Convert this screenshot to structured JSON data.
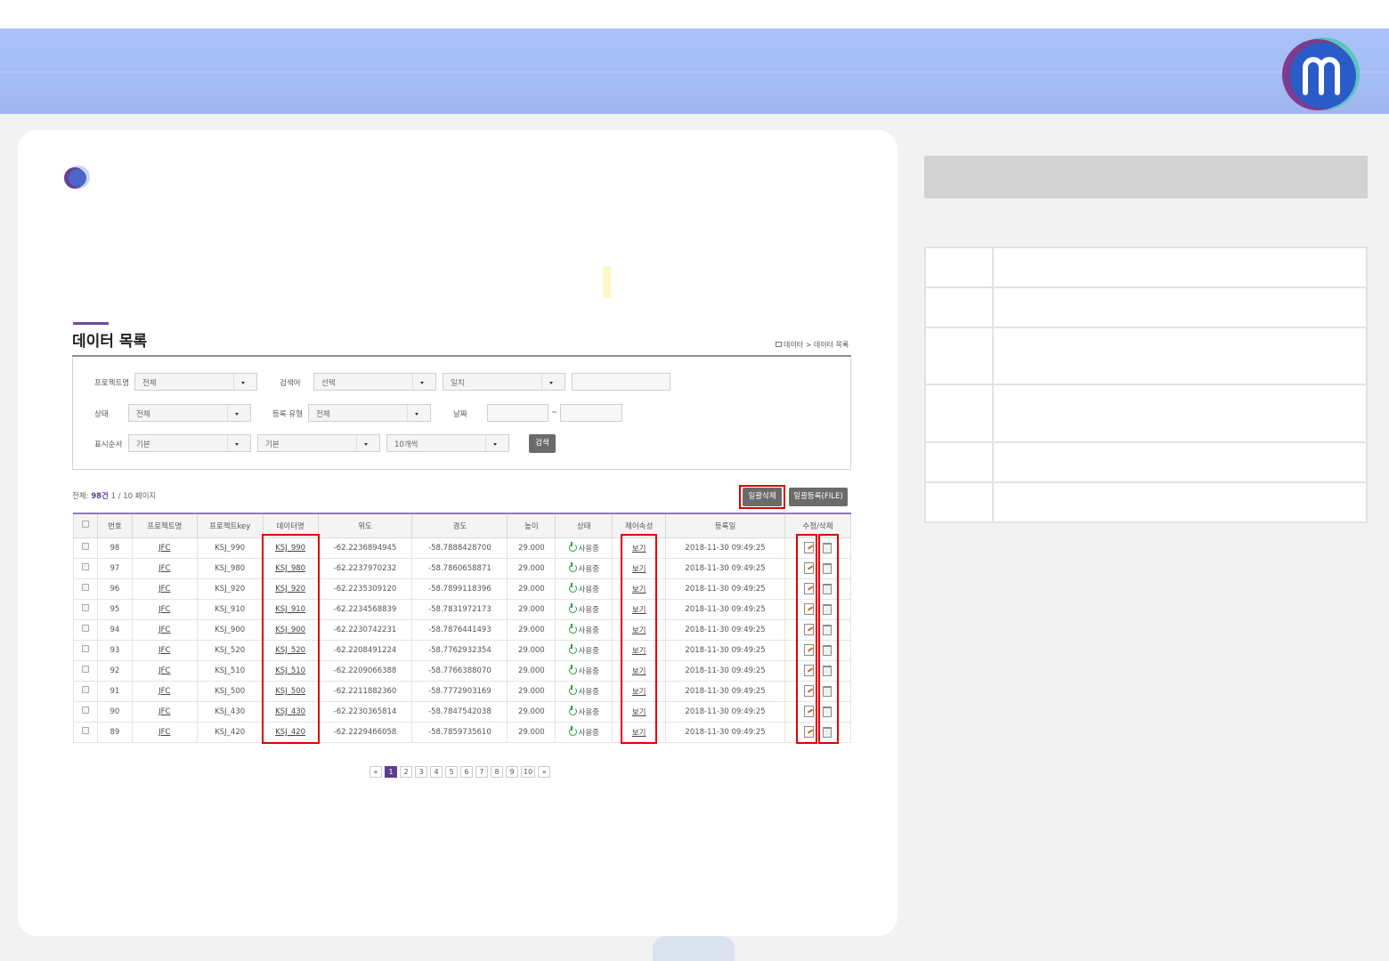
{
  "colors": {
    "header": "#a5bff6",
    "accent": "#5a3d8f",
    "highlight": "#e00000"
  },
  "screen": {
    "title": "데이터 목록",
    "breadcrumb": "데이터 > 데이터 목록",
    "search": {
      "project_label": "프로젝트명",
      "project_value": "전체",
      "keyword_label": "검색어",
      "keyword_value": "선택",
      "match_value": "일치",
      "status_label": "상태",
      "status_value": "전체",
      "reg_type_label": "등록 유형",
      "reg_type_value": "전체",
      "date_label": "날짜",
      "date_sep": "~",
      "order_label": "표시순서",
      "order_value1": "기본",
      "order_value2": "기본",
      "page_size_value": "10개씩",
      "search_button": "검색"
    },
    "total_prefix": "전체:",
    "total_count": "98건",
    "total_suffix": "1 / 10 페이지",
    "bulk_delete_button": "일괄삭제",
    "bulk_register_button": "일괄등록(FILE)",
    "columns": [
      "번호",
      "프로젝트명",
      "프로젝트key",
      "데이터명",
      "위도",
      "경도",
      "높이",
      "상태",
      "제어속성",
      "등록일",
      "수정/삭제"
    ],
    "rows": [
      {
        "no": "98",
        "project": "JFC",
        "key": "KSJ_990",
        "name": "KSJ_990",
        "lat": "-62.2236894945",
        "lon": "-58.7888428700",
        "alt": "29.000",
        "status": "사용중",
        "ctrl": "보기",
        "date": "2018-11-30 09:49:25"
      },
      {
        "no": "97",
        "project": "JFC",
        "key": "KSJ_980",
        "name": "KSJ_980",
        "lat": "-62.2237970232",
        "lon": "-58.7860658871",
        "alt": "29.000",
        "status": "사용중",
        "ctrl": "보기",
        "date": "2018-11-30 09:49:25"
      },
      {
        "no": "96",
        "project": "JFC",
        "key": "KSJ_920",
        "name": "KSJ_920",
        "lat": "-62.2235309120",
        "lon": "-58.7899118396",
        "alt": "29.000",
        "status": "사용중",
        "ctrl": "보기",
        "date": "2018-11-30 09:49:25"
      },
      {
        "no": "95",
        "project": "JFC",
        "key": "KSJ_910",
        "name": "KSJ_910",
        "lat": "-62.2234568839",
        "lon": "-58.7831972173",
        "alt": "29.000",
        "status": "사용중",
        "ctrl": "보기",
        "date": "2018-11-30 09:49:25"
      },
      {
        "no": "94",
        "project": "JFC",
        "key": "KSJ_900",
        "name": "KSJ_900",
        "lat": "-62.2230742231",
        "lon": "-58.7876441493",
        "alt": "29.000",
        "status": "사용중",
        "ctrl": "보기",
        "date": "2018-11-30 09:49:25"
      },
      {
        "no": "93",
        "project": "JFC",
        "key": "KSJ_520",
        "name": "KSJ_520",
        "lat": "-62.2208491224",
        "lon": "-58.7762932354",
        "alt": "29.000",
        "status": "사용중",
        "ctrl": "보기",
        "date": "2018-11-30 09:49:25"
      },
      {
        "no": "92",
        "project": "JFC",
        "key": "KSJ_510",
        "name": "KSJ_510",
        "lat": "-62.2209066388",
        "lon": "-58.7766388070",
        "alt": "29.000",
        "status": "사용중",
        "ctrl": "보기",
        "date": "2018-11-30 09:49:25"
      },
      {
        "no": "91",
        "project": "JFC",
        "key": "KSJ_500",
        "name": "KSJ_500",
        "lat": "-62.2211882360",
        "lon": "-58.7772903169",
        "alt": "29.000",
        "status": "사용중",
        "ctrl": "보기",
        "date": "2018-11-30 09:49:25"
      },
      {
        "no": "90",
        "project": "JFC",
        "key": "KSJ_430",
        "name": "KSJ_430",
        "lat": "-62.2230365814",
        "lon": "-58.7847542038",
        "alt": "29.000",
        "status": "사용중",
        "ctrl": "보기",
        "date": "2018-11-30 09:49:25"
      },
      {
        "no": "89",
        "project": "JFC",
        "key": "KSJ_420",
        "name": "KSJ_420",
        "lat": "-62.2229466058",
        "lon": "-58.7859735610",
        "alt": "29.000",
        "status": "사용중",
        "ctrl": "보기",
        "date": "2018-11-30 09:49:25"
      }
    ],
    "pagination": [
      "«",
      "1",
      "2",
      "3",
      "4",
      "5",
      "6",
      "7",
      "8",
      "9",
      "10",
      "»"
    ],
    "current_page": "1"
  }
}
